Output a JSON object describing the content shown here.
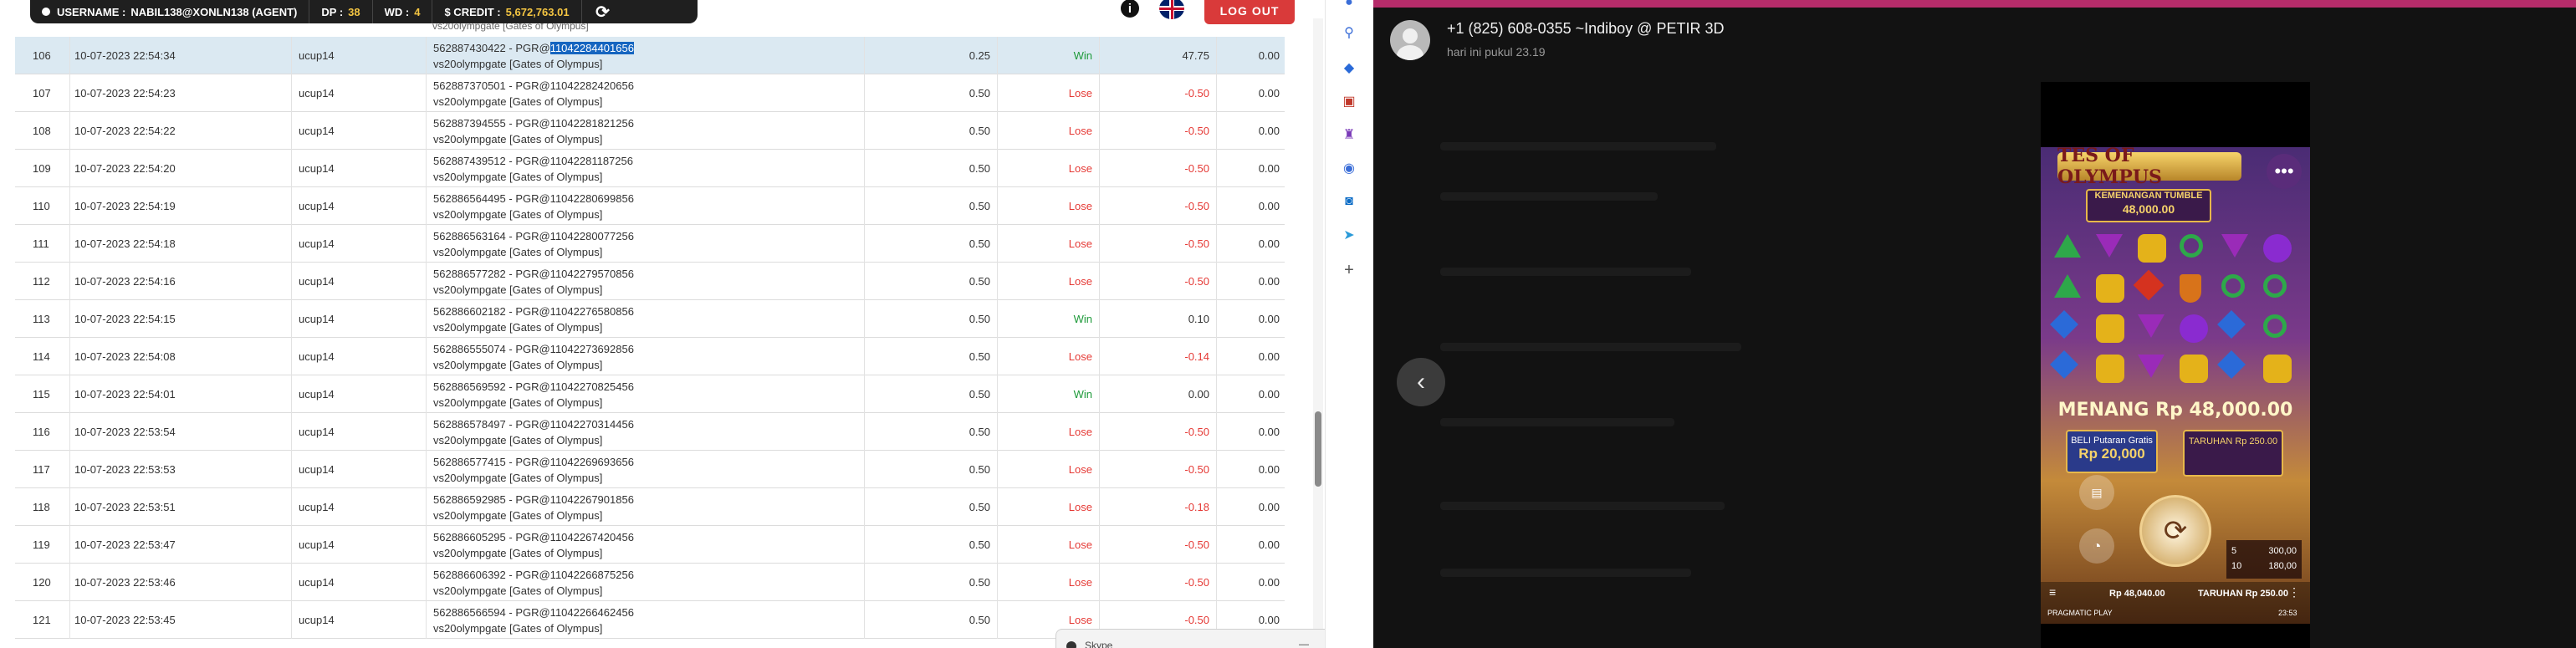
{
  "topbar": {
    "username_label": "USERNAME :",
    "username_value": "NABIL138@XONLN138 (AGENT)",
    "dp_label": "DP :",
    "dp_value": "38",
    "wd_label": "WD :",
    "wd_value": "4",
    "credit_label": "$ CREDIT :",
    "credit_value": "5,672,763.01",
    "info_glyph": "i",
    "refresh_glyph": "⟳",
    "logout_label": "LOG OUT"
  },
  "table": {
    "previous_fragment": "vs20olympgate [Gates of Olympus]",
    "rows": [
      {
        "no": "106",
        "datetime": "10-07-2023 22:54:34",
        "user": "ucup14",
        "desc_pre": "562887430422 - PGR@",
        "desc_hl": "11042284401656",
        "desc_post": "",
        "desc_line2": "vs20olympgate [Gates of Olympus]",
        "bet": "0.25",
        "result": "Win",
        "winlose": "47.75",
        "balance": "0.00"
      },
      {
        "no": "107",
        "datetime": "10-07-2023 22:54:23",
        "user": "ucup14",
        "desc_pre": "562887370501 - PGR@11042282420656",
        "desc_hl": "",
        "desc_post": "",
        "desc_line2": "vs20olympgate [Gates of Olympus]",
        "bet": "0.50",
        "result": "Lose",
        "winlose": "-0.50",
        "balance": "0.00"
      },
      {
        "no": "108",
        "datetime": "10-07-2023 22:54:22",
        "user": "ucup14",
        "desc_pre": "562887394555 - PGR@11042281821256",
        "desc_hl": "",
        "desc_post": "",
        "desc_line2": "vs20olympgate [Gates of Olympus]",
        "bet": "0.50",
        "result": "Lose",
        "winlose": "-0.50",
        "balance": "0.00"
      },
      {
        "no": "109",
        "datetime": "10-07-2023 22:54:20",
        "user": "ucup14",
        "desc_pre": "562887439512 - PGR@11042281187256",
        "desc_hl": "",
        "desc_post": "",
        "desc_line2": "vs20olympgate [Gates of Olympus]",
        "bet": "0.50",
        "result": "Lose",
        "winlose": "-0.50",
        "balance": "0.00"
      },
      {
        "no": "110",
        "datetime": "10-07-2023 22:54:19",
        "user": "ucup14",
        "desc_pre": "562886564495 - PGR@11042280699856",
        "desc_hl": "",
        "desc_post": "",
        "desc_line2": "vs20olympgate [Gates of Olympus]",
        "bet": "0.50",
        "result": "Lose",
        "winlose": "-0.50",
        "balance": "0.00"
      },
      {
        "no": "111",
        "datetime": "10-07-2023 22:54:18",
        "user": "ucup14",
        "desc_pre": "562886563164 - PGR@11042280077256",
        "desc_hl": "",
        "desc_post": "",
        "desc_line2": "vs20olympgate [Gates of Olympus]",
        "bet": "0.50",
        "result": "Lose",
        "winlose": "-0.50",
        "balance": "0.00"
      },
      {
        "no": "112",
        "datetime": "10-07-2023 22:54:16",
        "user": "ucup14",
        "desc_pre": "562886577282 - PGR@11042279570856",
        "desc_hl": "",
        "desc_post": "",
        "desc_line2": "vs20olympgate [Gates of Olympus]",
        "bet": "0.50",
        "result": "Lose",
        "winlose": "-0.50",
        "balance": "0.00"
      },
      {
        "no": "113",
        "datetime": "10-07-2023 22:54:15",
        "user": "ucup14",
        "desc_pre": "562886602182 - PGR@11042276580856",
        "desc_hl": "",
        "desc_post": "",
        "desc_line2": "vs20olympgate [Gates of Olympus]",
        "bet": "0.50",
        "result": "Win",
        "winlose": "0.10",
        "balance": "0.00"
      },
      {
        "no": "114",
        "datetime": "10-07-2023 22:54:08",
        "user": "ucup14",
        "desc_pre": "562886555074 - PGR@11042273692856",
        "desc_hl": "",
        "desc_post": "",
        "desc_line2": "vs20olympgate [Gates of Olympus]",
        "bet": "0.50",
        "result": "Lose",
        "winlose": "-0.14",
        "balance": "0.00"
      },
      {
        "no": "115",
        "datetime": "10-07-2023 22:54:01",
        "user": "ucup14",
        "desc_pre": "562886569592 - PGR@11042270825456",
        "desc_hl": "",
        "desc_post": "",
        "desc_line2": "vs20olympgate [Gates of Olympus]",
        "bet": "0.50",
        "result": "Win",
        "winlose": "0.00",
        "balance": "0.00"
      },
      {
        "no": "116",
        "datetime": "10-07-2023 22:53:54",
        "user": "ucup14",
        "desc_pre": "562886578497 - PGR@11042270314456",
        "desc_hl": "",
        "desc_post": "",
        "desc_line2": "vs20olympgate [Gates of Olympus]",
        "bet": "0.50",
        "result": "Lose",
        "winlose": "-0.50",
        "balance": "0.00"
      },
      {
        "no": "117",
        "datetime": "10-07-2023 22:53:53",
        "user": "ucup14",
        "desc_pre": "562886577415 - PGR@11042269693656",
        "desc_hl": "",
        "desc_post": "",
        "desc_line2": "vs20olympgate [Gates of Olympus]",
        "bet": "0.50",
        "result": "Lose",
        "winlose": "-0.50",
        "balance": "0.00"
      },
      {
        "no": "118",
        "datetime": "10-07-2023 22:53:51",
        "user": "ucup14",
        "desc_pre": "562886592985 - PGR@11042267901856",
        "desc_hl": "",
        "desc_post": "",
        "desc_line2": "vs20olympgate [Gates of Olympus]",
        "bet": "0.50",
        "result": "Lose",
        "winlose": "-0.18",
        "balance": "0.00"
      },
      {
        "no": "119",
        "datetime": "10-07-2023 22:53:47",
        "user": "ucup14",
        "desc_pre": "562886605295 - PGR@11042267420456",
        "desc_hl": "",
        "desc_post": "",
        "desc_line2": "vs20olympgate [Gates of Olympus]",
        "bet": "0.50",
        "result": "Lose",
        "winlose": "-0.50",
        "balance": "0.00"
      },
      {
        "no": "120",
        "datetime": "10-07-2023 22:53:46",
        "user": "ucup14",
        "desc_pre": "562886606392 - PGR@11042266875256",
        "desc_hl": "",
        "desc_post": "",
        "desc_line2": "vs20olympgate [Gates of Olympus]",
        "bet": "0.50",
        "result": "Lose",
        "winlose": "-0.50",
        "balance": "0.00"
      },
      {
        "no": "121",
        "datetime": "10-07-2023 22:53:45",
        "user": "ucup14",
        "desc_pre": "562886566594 - PGR@11042266462456",
        "desc_hl": "",
        "desc_post": "",
        "desc_line2": "vs20olympgate [Gates of Olympus]",
        "bet": "0.50",
        "result": "Lose",
        "winlose": "-0.50",
        "balance": "0.00"
      }
    ]
  },
  "chat_popup": {
    "label": "Skype",
    "minimize_glyph": "—",
    "close_glyph": "×"
  },
  "side_strip": {
    "icons": [
      "bell-icon",
      "search-icon",
      "tag-icon",
      "toolbox-icon",
      "game-icon",
      "globe-icon",
      "outlook-icon",
      "send-icon",
      "plus-icon"
    ]
  },
  "viewer": {
    "contact_name": "+1 (825) 608-0355 ~Indiboy @ PETIR 3D",
    "timestamp": "hari ini pukul 23.19",
    "back_glyph": "‹",
    "accent_color": "#b52c6a"
  },
  "game": {
    "title": "TES OF OLYMPUS",
    "dots_glyph": "•••",
    "tumble_label": "KEMENANGAN TUMBLE",
    "tumble_value": "48,000.00",
    "menang_text": "MENANG Rp 48,000.00",
    "buy_label": "BELI Putaran Gratis",
    "buy_value": "Rp 20,000",
    "double_label": "TARUHAN Rp 250.00",
    "spin_glyph": "⟳",
    "bet_rows": [
      {
        "k": "5",
        "v": "300,00"
      },
      {
        "k": "10",
        "v": "180,00"
      }
    ],
    "saldo_text": "Rp 48,040.00",
    "taruhan_text": "TARUHAN Rp 250.00",
    "brand": "PRAGMATIC PLAY",
    "clock": "23:53",
    "menu_glyph": "≡",
    "more_glyph": "⋮"
  }
}
